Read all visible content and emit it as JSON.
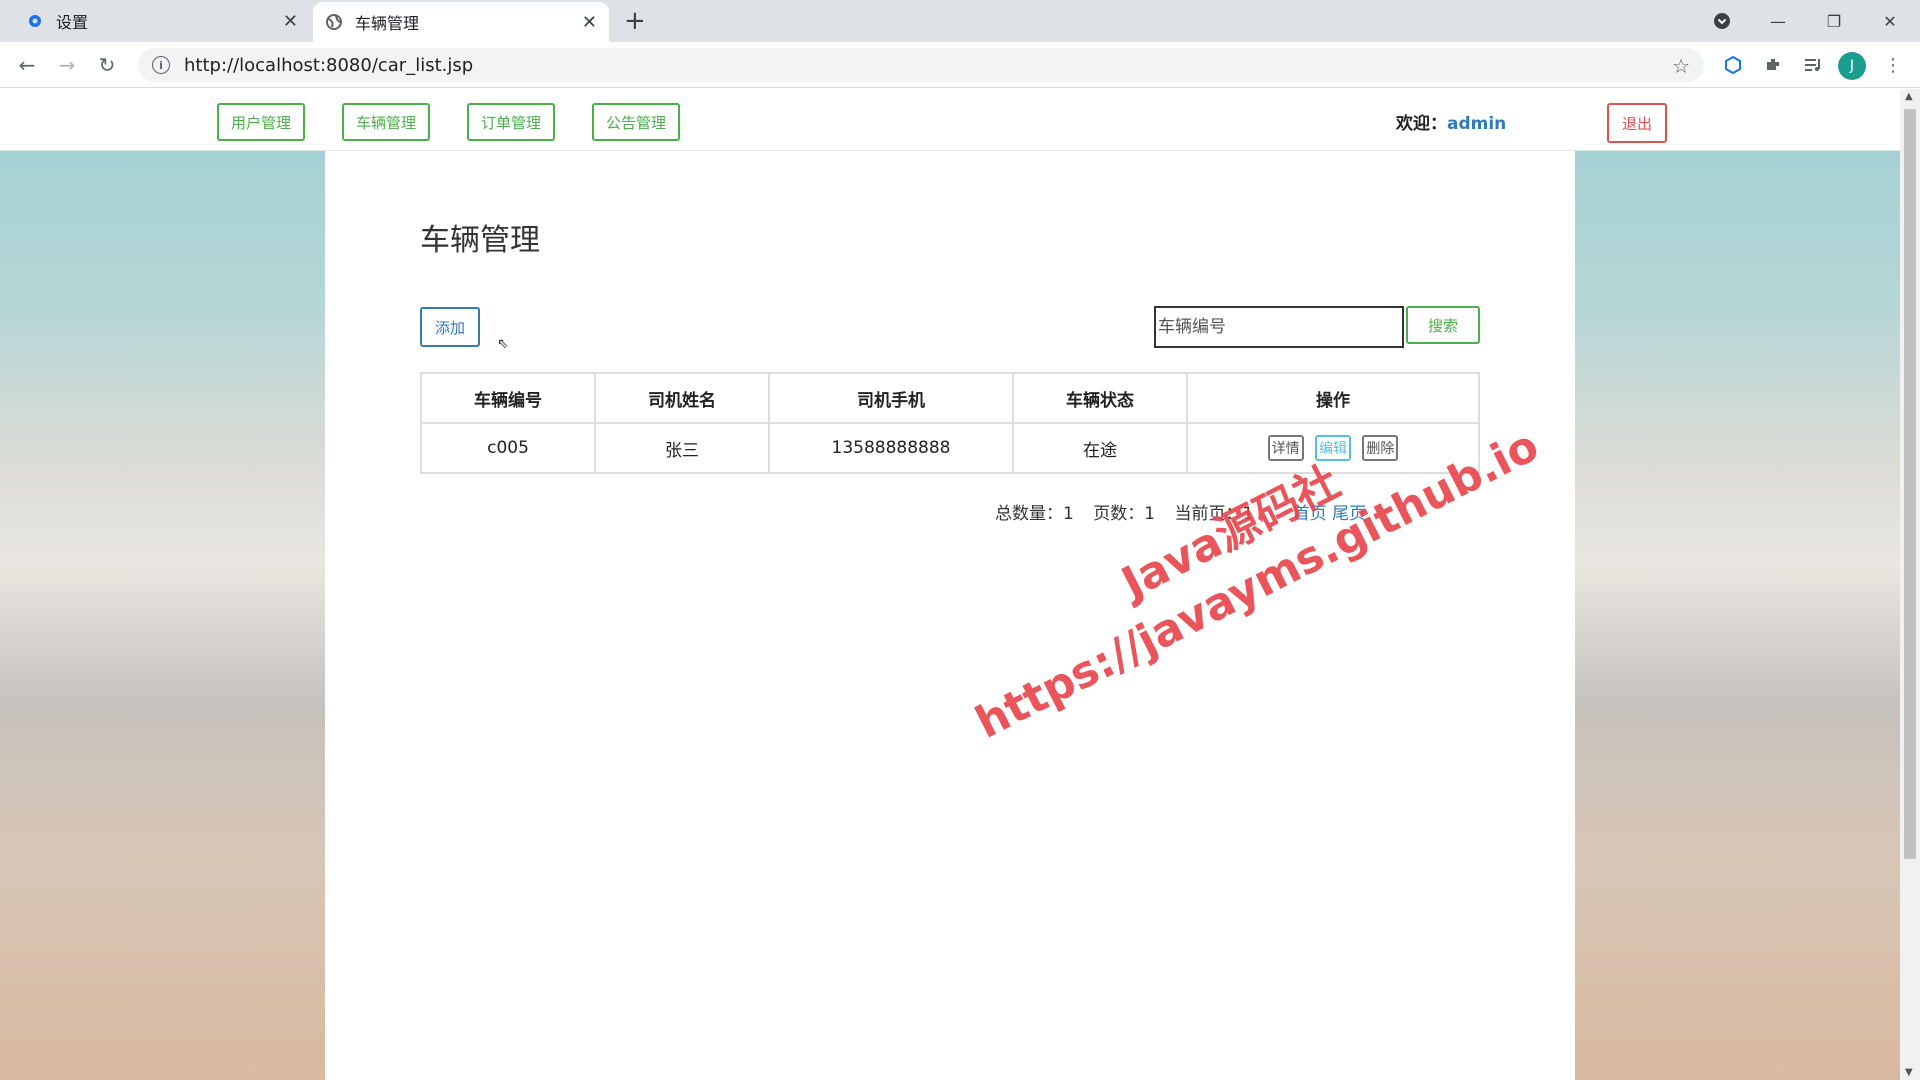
{
  "browser": {
    "tabs": [
      {
        "title": "设置",
        "icon": "gear-icon"
      },
      {
        "title": "车辆管理",
        "icon": "globe-icon"
      }
    ],
    "url": "http://localhost:8080/car_list.jsp",
    "avatar_letter": "J"
  },
  "topnav": {
    "items": [
      "用户管理",
      "车辆管理",
      "订单管理",
      "公告管理"
    ],
    "welcome_label": "欢迎：",
    "username": "admin",
    "logout_label": "退出"
  },
  "main": {
    "title": "车辆管理",
    "add_label": "添加",
    "search_placeholder": "车辆编号",
    "search_label": "搜索",
    "table": {
      "headers": [
        "车辆编号",
        "司机姓名",
        "司机手机",
        "车辆状态",
        "操作"
      ],
      "rows": [
        {
          "car_no": "c005",
          "driver": "张三",
          "phone": "13588888888",
          "status": "在途",
          "actions": [
            "详情",
            "编辑",
            "删除"
          ]
        }
      ]
    },
    "pager": {
      "total_label": "总数量：1",
      "pages_label": "页数：1",
      "current_label": "当前页：1",
      "first_label": "首页",
      "last_label": "尾页"
    }
  },
  "watermark": {
    "line1": "Java源码社",
    "line2": "https://javayms.github.io"
  },
  "colors": {
    "success": "#4cae4c",
    "primary": "#337ab7",
    "danger": "#d9534f",
    "info": "#5bc0de",
    "watermark": "#e8434a"
  }
}
